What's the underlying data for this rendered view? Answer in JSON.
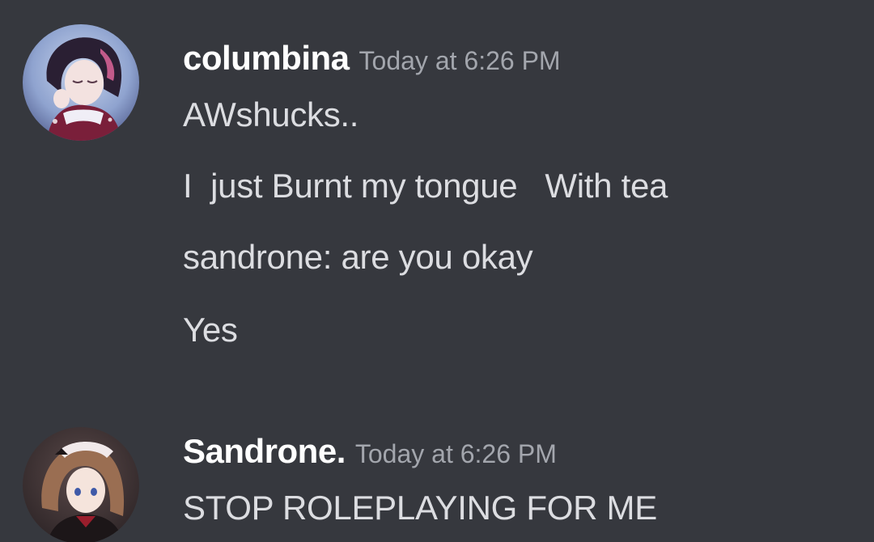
{
  "colors": {
    "background": "#36383e",
    "username": "#ffffff",
    "timestamp": "#a3a6ad",
    "message_text": "#dcdde1"
  },
  "messages": [
    {
      "username": "columbina",
      "timestamp": "Today at 6:26 PM",
      "avatar_icon": "avatar-columbina",
      "lines": [
        "AWshucks..",
        "I  just Burnt my tongue   With tea",
        "sandrone: are you okay",
        "Yes"
      ]
    },
    {
      "username": "Sandrone.",
      "timestamp": "Today at 6:26 PM",
      "avatar_icon": "avatar-sandrone",
      "lines": [
        "STOP ROLEPLAYING FOR ME"
      ]
    }
  ]
}
